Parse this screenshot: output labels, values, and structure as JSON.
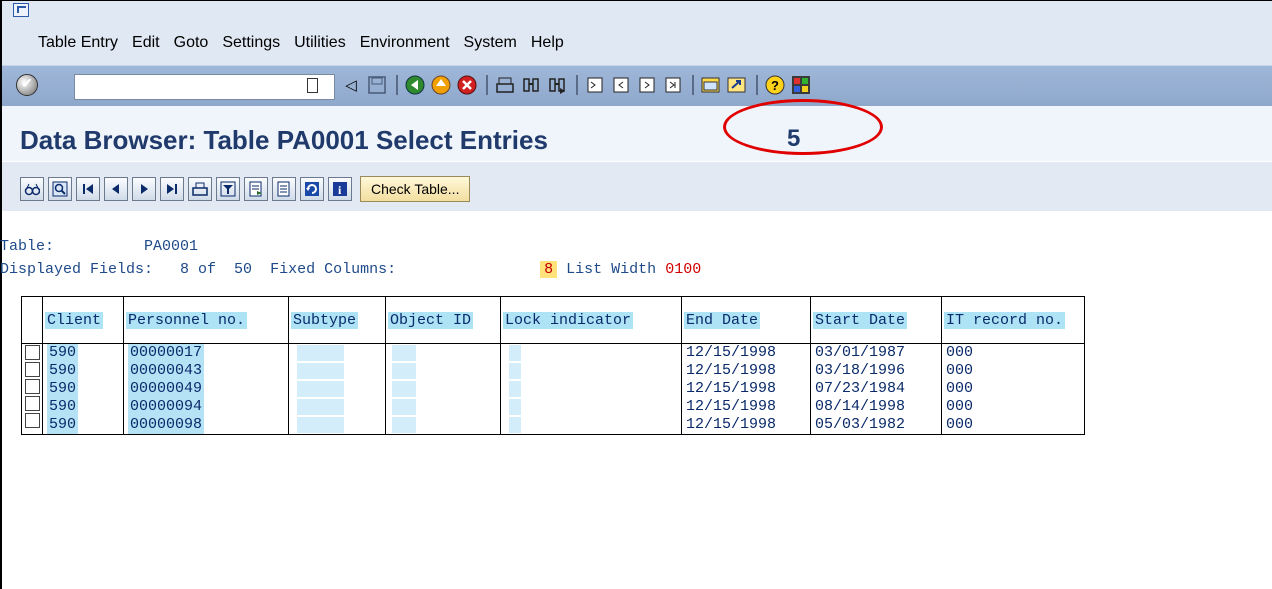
{
  "menu": {
    "items": [
      "Table Entry",
      "Edit",
      "Goto",
      "Settings",
      "Utilities",
      "Environment",
      "System",
      "Help"
    ]
  },
  "toolbar": {
    "okcode_value": "",
    "icons": [
      "enter-icon",
      "dropdown-icon",
      "back-arrow-icon",
      "save-icon",
      "back-icon",
      "exit-icon",
      "cancel-icon",
      "print-icon",
      "find-icon",
      "find-next-icon",
      "first-page-icon",
      "prev-page-icon",
      "next-page-icon",
      "last-page-icon",
      "new-session-icon",
      "shortcut-icon",
      "help-icon",
      "customize-layout-icon"
    ]
  },
  "title": {
    "text": "Data Browser: Table PA0001 Select Entries",
    "count": "5"
  },
  "app_toolbar": {
    "check_table_label": "Check Table..."
  },
  "info": {
    "table_label": "Table:",
    "table_value": "PA0001",
    "displayed_label": "Displayed Fields:",
    "displayed_value": "8 of  50",
    "fixed_label": "Fixed Columns:",
    "fixed_value": "8",
    "width_label": "List Width",
    "width_value": "0100"
  },
  "table": {
    "columns": [
      "Client",
      "Personnel no.",
      "Subtype",
      "Object ID",
      "Lock indicator",
      "End Date",
      "Start Date",
      "IT record no."
    ],
    "rows": [
      {
        "client": "590",
        "pernr": "00000017",
        "end": "12/15/1998",
        "start": "03/01/1987",
        "itrec": "000"
      },
      {
        "client": "590",
        "pernr": "00000043",
        "end": "12/15/1998",
        "start": "03/18/1996",
        "itrec": "000"
      },
      {
        "client": "590",
        "pernr": "00000049",
        "end": "12/15/1998",
        "start": "07/23/1984",
        "itrec": "000"
      },
      {
        "client": "590",
        "pernr": "00000094",
        "end": "12/15/1998",
        "start": "08/14/1998",
        "itrec": "000"
      },
      {
        "client": "590",
        "pernr": "00000098",
        "end": "12/15/1998",
        "start": "05/03/1982",
        "itrec": "000"
      }
    ]
  },
  "colors": {
    "title": "#1f3a6b",
    "highlight_ring": "#e00000",
    "header_cell": "#aee3f6"
  }
}
